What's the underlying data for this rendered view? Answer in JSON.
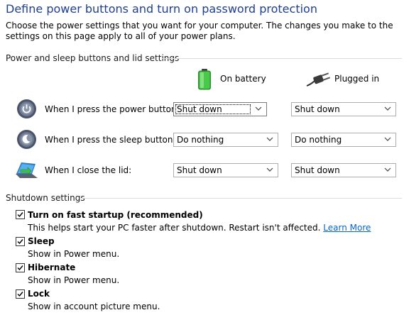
{
  "header": {
    "title": "Define power buttons and turn on password protection",
    "description": "Choose the power settings that you want for your computer. The changes you make to the settings on this page apply to all of your power plans."
  },
  "power_section": {
    "group_label": "Power and sleep buttons and lid settings",
    "columns": {
      "battery": "On battery",
      "plugged": "Plugged in"
    },
    "rows": [
      {
        "label": "When I press the power button:",
        "icon": "power-button-icon",
        "battery": "Shut down",
        "plugged": "Shut down"
      },
      {
        "label": "When I press the sleep button:",
        "icon": "sleep-button-icon",
        "battery": "Do nothing",
        "plugged": "Do nothing"
      },
      {
        "label": "When I close the lid:",
        "icon": "laptop-lid-icon",
        "battery": "Shut down",
        "plugged": "Shut down"
      }
    ]
  },
  "shutdown_section": {
    "group_label": "Shutdown settings",
    "options": [
      {
        "label": "Turn on fast startup (recommended)",
        "checked": true,
        "description": "This helps start your PC faster after shutdown. Restart isn't affected.",
        "link": "Learn More"
      },
      {
        "label": "Sleep",
        "checked": true,
        "description": "Show in Power menu."
      },
      {
        "label": "Hibernate",
        "checked": true,
        "description": "Show in Power menu."
      },
      {
        "label": "Lock",
        "checked": true,
        "description": "Show in account picture menu."
      }
    ]
  },
  "colors": {
    "title": "#1e3e93",
    "link": "#0066cc",
    "battery_green": "#3cb43c"
  }
}
